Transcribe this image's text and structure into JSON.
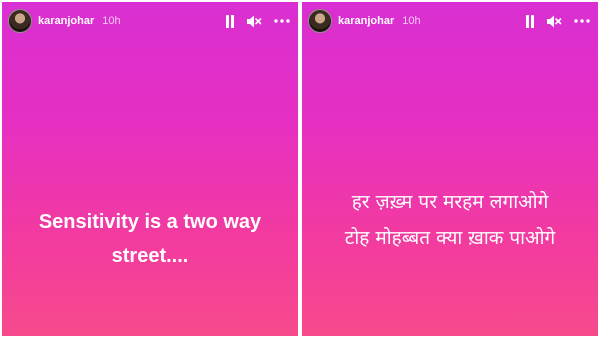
{
  "stories": [
    {
      "username": "karanjohar",
      "time": "10h",
      "lines": [
        "Sensitivity is a two way",
        "street...."
      ]
    },
    {
      "username": "karanjohar",
      "time": "10h",
      "lines": [
        "हर ज़ख़्म पर मरहम लगाओगे",
        "टोह मोहब्बत क्या ख़ाक पाओगे"
      ]
    }
  ],
  "icons": {
    "pause": "pause-icon",
    "mute": "speaker-muted-icon",
    "more": "more-horizontal-icon"
  },
  "colors": {
    "gradient_top": "#d92fd2",
    "gradient_bottom": "#f74a8c",
    "text": "#ffffff"
  }
}
